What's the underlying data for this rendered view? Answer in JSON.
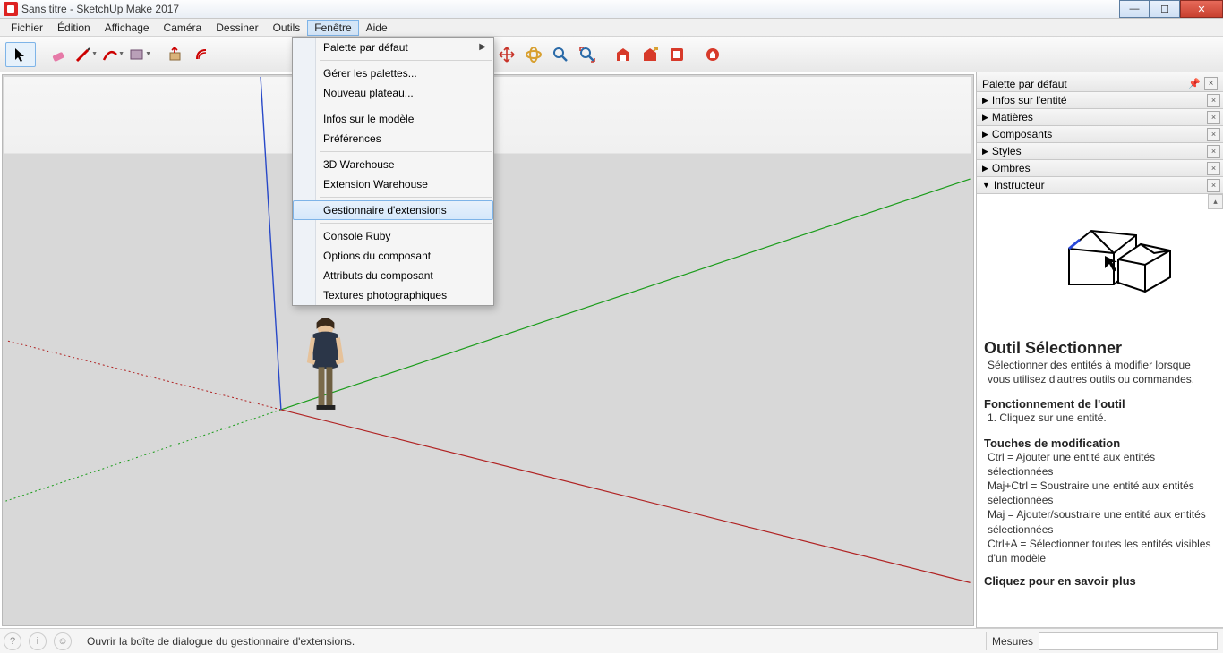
{
  "window": {
    "title": "Sans titre - SketchUp Make 2017"
  },
  "menus": {
    "items": [
      "Fichier",
      "Édition",
      "Affichage",
      "Caméra",
      "Dessiner",
      "Outils",
      "Fenêtre",
      "Aide"
    ],
    "open_index": 6
  },
  "dropdown": {
    "items": [
      {
        "label": "Palette par défaut",
        "submenu": true
      },
      {
        "sep": true
      },
      {
        "label": "Gérer les palettes..."
      },
      {
        "label": "Nouveau plateau..."
      },
      {
        "sep": true
      },
      {
        "label": "Infos sur le modèle"
      },
      {
        "label": "Préférences"
      },
      {
        "sep": true
      },
      {
        "label": "3D Warehouse"
      },
      {
        "label": "Extension Warehouse"
      },
      {
        "sep": true
      },
      {
        "label": "Gestionnaire d'extensions",
        "hover": true
      },
      {
        "sep": true
      },
      {
        "label": "Console Ruby"
      },
      {
        "label": "Options du composant"
      },
      {
        "label": "Attributs du composant"
      },
      {
        "label": "Textures photographiques"
      }
    ]
  },
  "tray": {
    "title": "Palette par défaut",
    "panels": [
      {
        "label": "Infos sur l'entité",
        "open": false
      },
      {
        "label": "Matières",
        "open": false
      },
      {
        "label": "Composants",
        "open": false
      },
      {
        "label": "Styles",
        "open": false
      },
      {
        "label": "Ombres",
        "open": false
      },
      {
        "label": "Instructeur",
        "open": true
      }
    ]
  },
  "instructor": {
    "title": "Outil Sélectionner",
    "desc": "Sélectionner des entités à modifier lorsque vous utilisez d'autres outils ou commandes.",
    "op_head": "Fonctionnement de l'outil",
    "op_1": "1. Cliquez sur une entité.",
    "mod_head": "Touches de modification",
    "mod_1": "Ctrl = Ajouter une entité aux entités sélectionnées",
    "mod_2": "Maj+Ctrl = Soustraire une entité aux entités sélectionnées",
    "mod_3": "Maj = Ajouter/soustraire une entité aux entités sélectionnées",
    "mod_4": "Ctrl+A = Sélectionner toutes les entités visibles d'un modèle",
    "more": "Cliquez pour en savoir plus"
  },
  "status": {
    "hint": "Ouvrir la boîte de dialogue du gestionnaire d'extensions.",
    "measure_label": "Mesures"
  }
}
